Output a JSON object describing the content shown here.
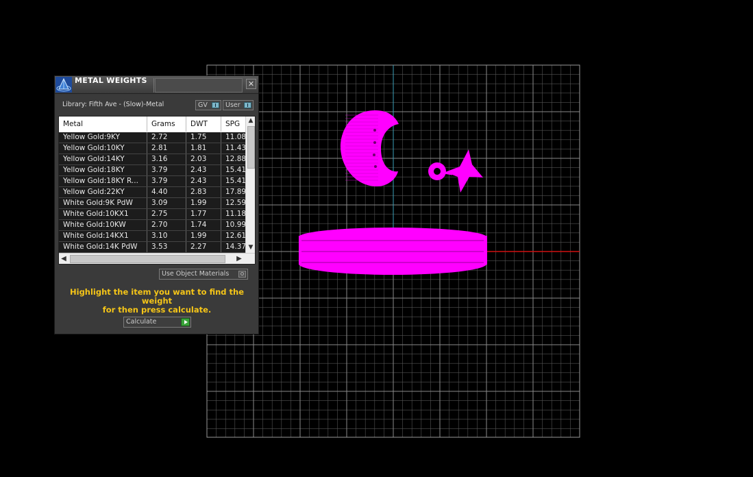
{
  "window": {
    "title": "METAL WEIGHTS",
    "close_glyph": "✕"
  },
  "library": {
    "label": "Library: Fifth Ave - (Slow)-Metal",
    "gv_label": "GV",
    "user_label": "User"
  },
  "table": {
    "columns": [
      "Metal",
      "Grams",
      "DWT",
      "SPG"
    ],
    "rows": [
      [
        "Yellow Gold:9KY",
        "2.72",
        "1.75",
        "11.08"
      ],
      [
        "Yellow Gold:10KY",
        "2.81",
        "1.81",
        "11.43"
      ],
      [
        "Yellow Gold:14KY",
        "3.16",
        "2.03",
        "12.88"
      ],
      [
        "Yellow Gold:18KY",
        "3.79",
        "2.43",
        "15.41"
      ],
      [
        "Yellow Gold:18KY R...",
        "3.79",
        "2.43",
        "15.41"
      ],
      [
        "Yellow Gold:22KY",
        "4.40",
        "2.83",
        "17.89"
      ],
      [
        "White Gold:9K PdW",
        "3.09",
        "1.99",
        "12.59"
      ],
      [
        "White Gold:10KX1",
        "2.75",
        "1.77",
        "11.18"
      ],
      [
        "White Gold:10KW",
        "2.70",
        "1.74",
        "10.99"
      ],
      [
        "White Gold:14KX1",
        "3.10",
        "1.99",
        "12.61"
      ],
      [
        "White Gold:14K PdW",
        "3.53",
        "2.27",
        "14.37"
      ]
    ],
    "scroll_up": "▲",
    "scroll_down": "▼",
    "scroll_left": "◀",
    "scroll_right": "▶"
  },
  "options": {
    "use_object_materials": "Use Object Materials"
  },
  "hint": {
    "line1": "Highlight the item you want to find the weight",
    "line2": "for then press calculate."
  },
  "actions": {
    "calculate_label": "Calculate"
  },
  "colors": {
    "model": "#ff00ff",
    "grid_line": "#7f7f7f",
    "axis_y": "#3aa0b8",
    "axis_x": "#d01010",
    "hint_text": "#f5c518"
  },
  "icons": {
    "app": "pyramid-app-icon",
    "close": "close-icon"
  }
}
